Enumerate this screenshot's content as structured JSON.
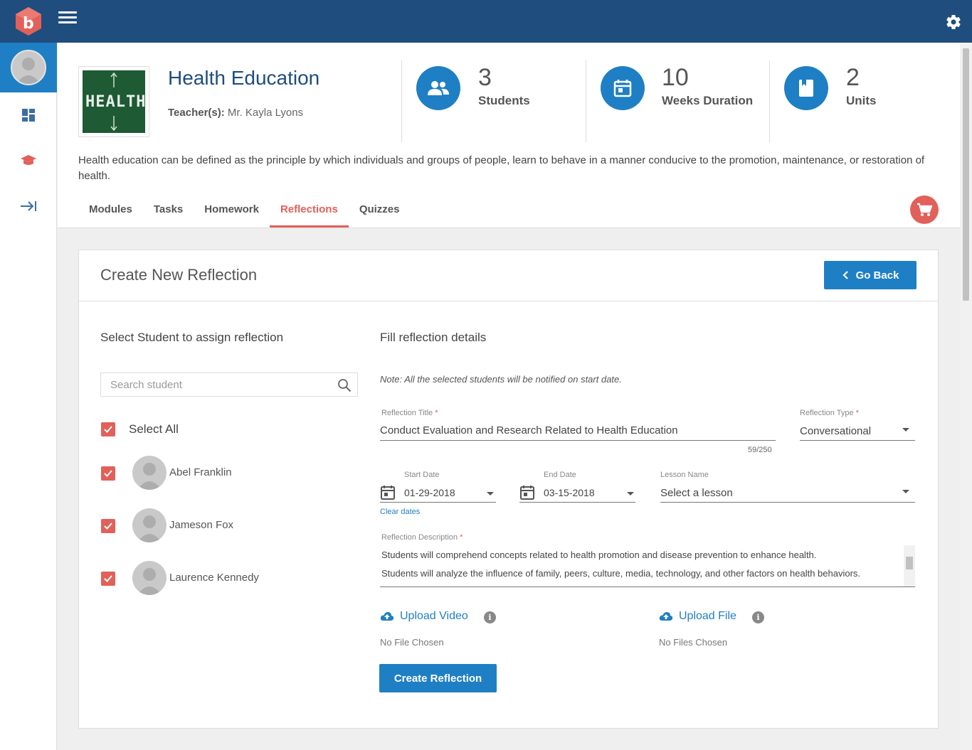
{
  "header": {
    "course_title": "Health Education",
    "course_image_text": "HEALTH",
    "teacher_label": "Teacher(s):",
    "teacher_name": "Mr. Kayla Lyons",
    "description": "Health education can be defined as the principle by which individuals and groups of people, learn to behave in a manner conducive to the promotion, maintenance, or restoration of health.",
    "stats": [
      {
        "value": "3",
        "label": "Students",
        "icon": "students-icon"
      },
      {
        "value": "10",
        "label": "Weeks Duration",
        "icon": "calendar-icon"
      },
      {
        "value": "2",
        "label": "Units",
        "icon": "book-icon"
      }
    ],
    "tabs": [
      {
        "label": "Modules",
        "active": false
      },
      {
        "label": "Tasks",
        "active": false
      },
      {
        "label": "Homework",
        "active": false
      },
      {
        "label": "Reflections",
        "active": true
      },
      {
        "label": "Quizzes",
        "active": false
      }
    ]
  },
  "card": {
    "title": "Create New Reflection",
    "go_back_label": "Go Back"
  },
  "students_section": {
    "title": "Select Student to assign reflection",
    "search_placeholder": "Search student",
    "select_all_label": "Select All",
    "students": [
      {
        "name": "Abel Franklin",
        "checked": true
      },
      {
        "name": "Jameson Fox",
        "checked": true
      },
      {
        "name": "Laurence Kennedy",
        "checked": true
      }
    ]
  },
  "details_section": {
    "title": "Fill reflection details",
    "note": "Note: All the selected students will be notified on start date.",
    "reflection_title_label": "Reflection Title",
    "reflection_title_value": "Conduct Evaluation and Research Related to Health Education",
    "reflection_title_counter": "59/250",
    "reflection_type_label": "Reflection Type",
    "reflection_type_value": "Conversational",
    "start_date_label": "Start Date",
    "start_date_value": "01-29-2018",
    "end_date_label": "End Date",
    "end_date_value": "03-15-2018",
    "clear_dates_label": "Clear dates",
    "lesson_name_label": "Lesson Name",
    "lesson_name_value": "Select a lesson",
    "description_label": "Reflection Description",
    "description_lines": [
      "Students will comprehend concepts related to health promotion and disease prevention to enhance health.",
      "Students will analyze the influence of family, peers, culture, media, technology, and other factors on health behaviors."
    ],
    "upload_video_label": "Upload Video",
    "upload_video_status": "No File Chosen",
    "upload_file_label": "Upload File",
    "upload_file_status": "No Files Chosen",
    "info_glyph": "i",
    "create_button_label": "Create Reflection"
  },
  "colors": {
    "topbar": "#1f4d7e",
    "accent_blue": "#1f7fc4",
    "accent_red": "#e2605a"
  }
}
